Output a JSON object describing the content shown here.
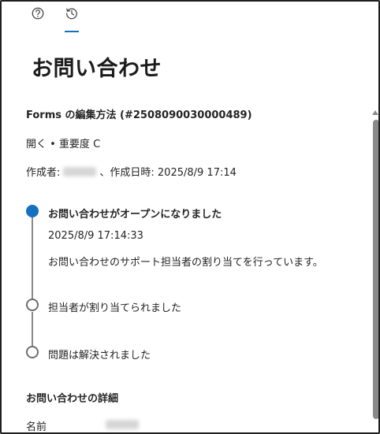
{
  "tabs": [
    {
      "label": "",
      "icon": "help-icon"
    },
    {
      "label": "",
      "icon": "history-icon",
      "selected": true
    }
  ],
  "page": {
    "title": "お問い合わせ"
  },
  "ticket": {
    "subject": "Forms の編集方法 (#2508090030000489)",
    "status_line": "開く • 重要度 C",
    "created_by_label": "作成者:",
    "created_at_label": "、作成日時: 2025/8/9 17:14"
  },
  "timeline": [
    {
      "title": "お問い合わせがオープンになりました",
      "time": "2025/8/9 17:14:33",
      "description": "お問い合わせのサポート担当者の割り当てを行っています。",
      "state": "complete"
    },
    {
      "title": "担当者が割り当てられました",
      "state": "pending"
    },
    {
      "title": "問題は解決されました",
      "state": "pending"
    }
  ],
  "details": {
    "heading": "お問い合わせの詳細",
    "name_label": "名前"
  },
  "colors": {
    "accent": "#1570c0",
    "text": "#242424",
    "scrollbar": "#8a8a8a"
  }
}
